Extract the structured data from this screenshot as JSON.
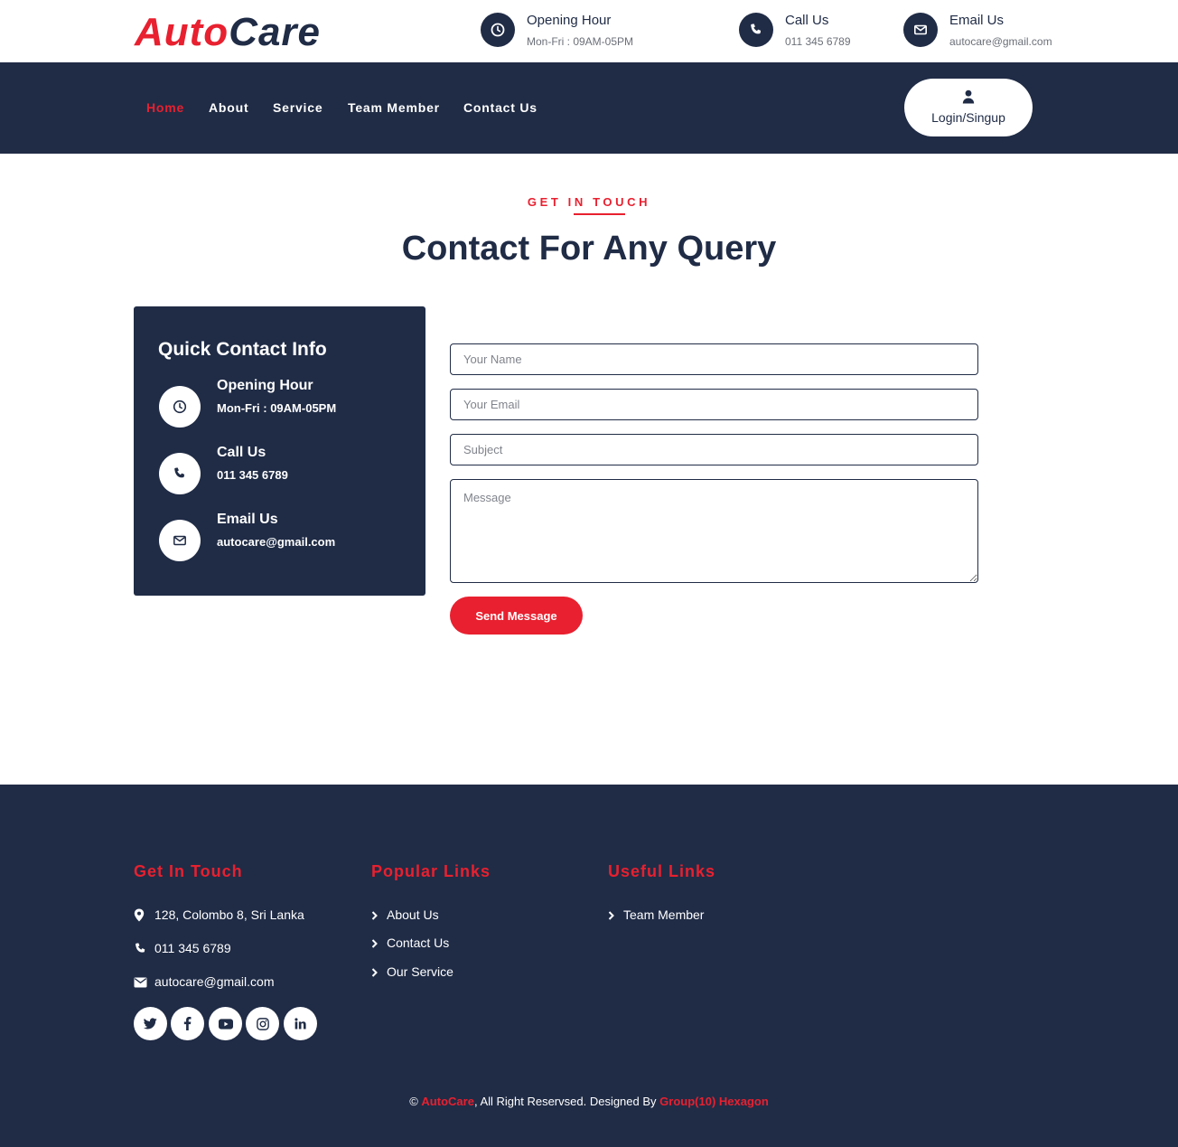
{
  "brand": {
    "part1": "Auto",
    "part2": "Care"
  },
  "topbar": {
    "opening": {
      "icon": "clock-icon",
      "title": "Opening Hour",
      "value": "Mon-Fri : 09AM-05PM"
    },
    "call": {
      "icon": "phone-icon",
      "title": "Call Us",
      "value": "011 345 6789"
    },
    "email": {
      "icon": "envelope-icon",
      "title": "Email Us",
      "value": "autocare@gmail.com"
    }
  },
  "nav": {
    "items": [
      "Home",
      "About",
      "Service",
      "Team Member",
      "Contact Us"
    ],
    "active": "Home",
    "login_label": "Login/Singup"
  },
  "section": {
    "eyebrow": "GET IN TOUCH",
    "title": "Contact For Any Query"
  },
  "quick_contact": {
    "title": "Quick Contact Info",
    "items": [
      {
        "icon": "clock-icon",
        "title": "Opening Hour",
        "value": "Mon-Fri : 09AM-05PM"
      },
      {
        "icon": "phone-icon",
        "title": "Call Us",
        "value": "011 345 6789"
      },
      {
        "icon": "envelope-icon",
        "title": "Email Us",
        "value": "autocare@gmail.com"
      }
    ]
  },
  "form": {
    "name_placeholder": "Your Name",
    "email_placeholder": "Your Email",
    "subject_placeholder": "Subject",
    "message_placeholder": "Message",
    "submit_label": "Send Message"
  },
  "footer": {
    "get_in_touch": {
      "title": "Get In Touch",
      "address": "128, Colombo 8, Sri Lanka",
      "phone": "011 345 6789",
      "email": "autocare@gmail.com"
    },
    "popular_links": {
      "title": "Popular Links",
      "items": [
        "About Us",
        "Contact Us",
        "Our Service"
      ]
    },
    "useful_links": {
      "title": "Useful Links",
      "items": [
        "Team Member"
      ]
    },
    "social": [
      "twitter-icon",
      "facebook-icon",
      "youtube-icon",
      "instagram-icon",
      "linkedin-icon"
    ],
    "copyright": {
      "symbol": "©",
      "brand": "AutoCare",
      "middle": ", All Right Reservsed. Designed By ",
      "designer": "Group(10) Hexagon"
    }
  },
  "colors": {
    "navy": "#202c46",
    "red": "#e8202f",
    "white": "#ffffff"
  }
}
